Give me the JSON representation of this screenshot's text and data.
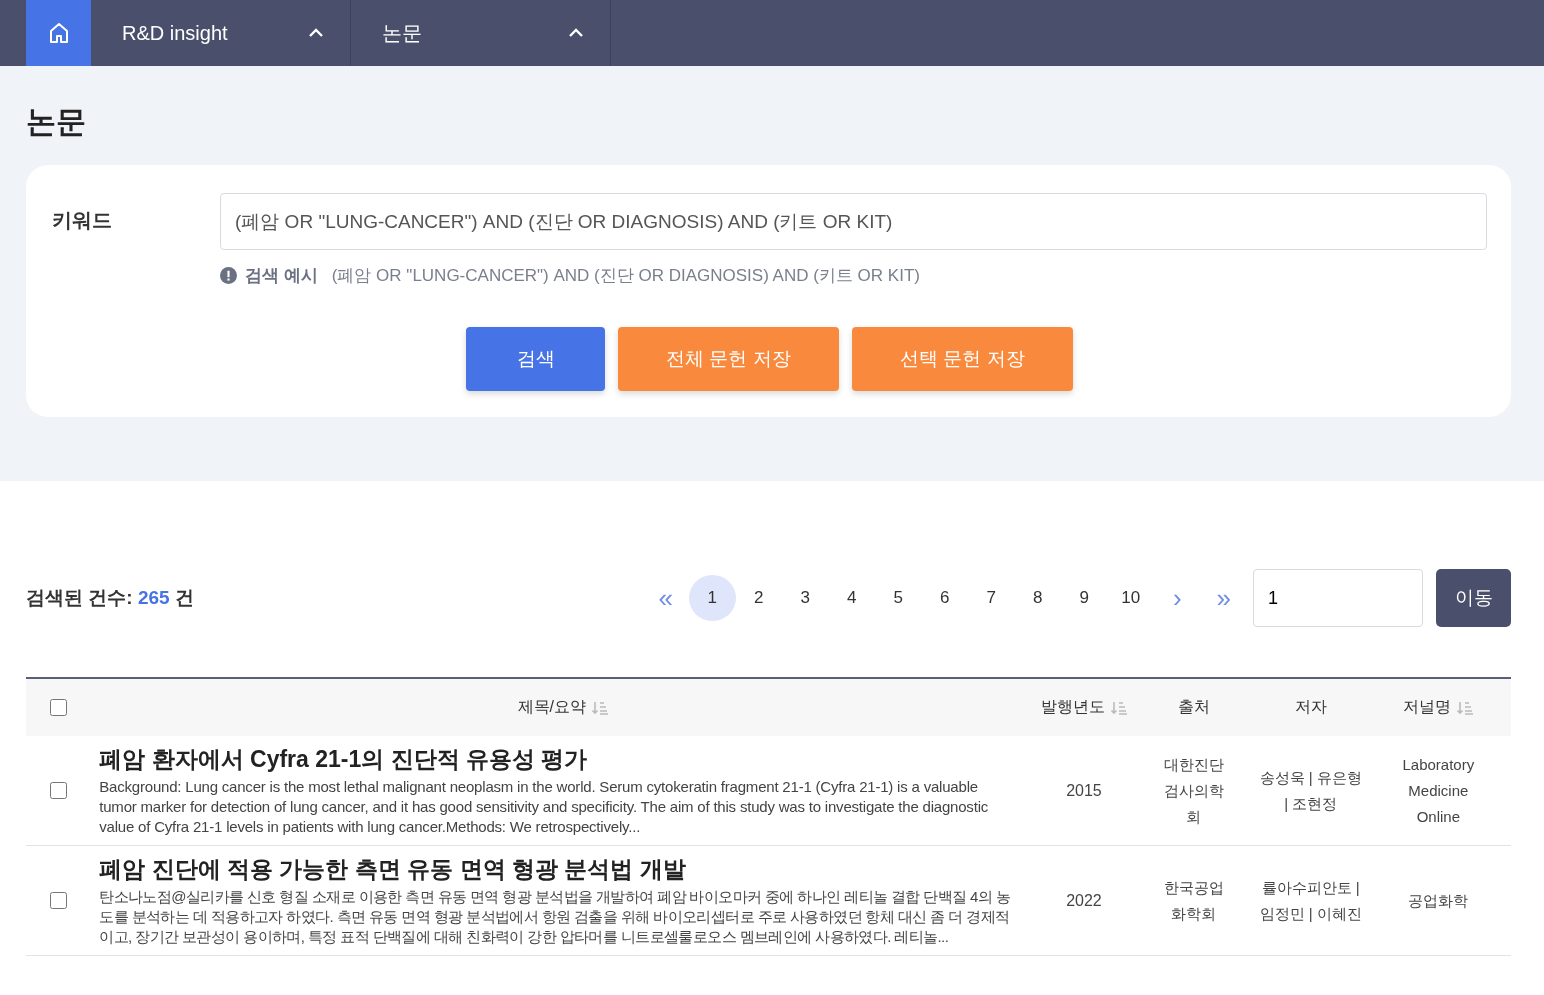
{
  "nav": {
    "items": [
      {
        "label": "R&D insight",
        "expanded": true
      },
      {
        "label": "논문",
        "expanded": true
      }
    ]
  },
  "page_title": "논문",
  "search": {
    "label": "키워드",
    "value": "(폐암 OR \"LUNG-CANCER\") AND (진단 OR DIAGNOSIS) AND (키트 OR KIT)",
    "hint_label": "검색 예시",
    "hint_text": "(폐암 OR \"LUNG-CANCER\") AND (진단 OR DIAGNOSIS) AND (키트 OR KIT)"
  },
  "buttons": [
    {
      "label": "검색",
      "kind": "primary"
    },
    {
      "label": "전체 문헌 저장",
      "kind": "accent"
    },
    {
      "label": "선택 문헌 저장",
      "kind": "accent"
    }
  ],
  "result_count": {
    "label": "검색된 건수:",
    "count": "265",
    "unit": "건"
  },
  "pagination": {
    "first": "«",
    "next": "›",
    "last": "»",
    "pages": [
      {
        "label": "1",
        "selected": true
      },
      {
        "label": "2",
        "selected": false
      },
      {
        "label": "3",
        "selected": false
      },
      {
        "label": "4",
        "selected": false
      },
      {
        "label": "5",
        "selected": false
      },
      {
        "label": "6",
        "selected": false
      },
      {
        "label": "7",
        "selected": false
      },
      {
        "label": "8",
        "selected": false
      },
      {
        "label": "9",
        "selected": false
      },
      {
        "label": "10",
        "selected": false
      }
    ],
    "goto_value": "1",
    "goto_button": "이동"
  },
  "table": {
    "select_all_checked": false,
    "columns": [
      {
        "label": "제목/요약",
        "sortable": true
      },
      {
        "label": "발행년도",
        "sortable": true
      },
      {
        "label": "출처",
        "sortable": false
      },
      {
        "label": "저자",
        "sortable": false
      },
      {
        "label": "저널명",
        "sortable": true
      }
    ],
    "rows": [
      {
        "checked": false,
        "title": "폐암 환자에서 Cyfra 21-1의 진단적 유용성 평가",
        "abstract": "Background: Lung cancer is the most lethal malignant neoplasm in the world. Serum cytokeratin fragment 21-1 (Cyfra 21-1) is a valuable tumor marker for detection of lung cancer, and it has good sensitivity and specificity. The aim of this study was to investigate the diagnostic value of Cyfra 21-1 levels in patients with lung cancer.Methods: We retrospectively...",
        "year": "2015",
        "source": "대한진단검사의학회",
        "authors": "송성욱 | 유은형 | 조현정",
        "journal": "Laboratory Medicine Online"
      },
      {
        "checked": false,
        "title": "폐암 진단에 적용 가능한 측면 유동 면역 형광 분석법 개발",
        "abstract": "탄소나노점@실리카를 신호 형질 소재로 이용한 측면 유동 면역 형광 분석법을 개발하여 폐암 바이오마커 중에 하나인 레티놀 결합 단백질 4의 농도를 분석하는 데 적용하고자 하였다. 측면 유동 면역 형광 분석법에서 항원 검출을 위해 바이오리셉터로 주로 사용하였던 항체 대신 좀 더 경제적이고, 장기간 보관성이 용이하며, 특정 표적 단백질에 대해 친화력이 강한 압타머를 니트로셀룰로오스 멤브레인에 사용하였다. 레티놀...",
        "year": "2022",
        "source": "한국공업화학회",
        "authors": "률아수피안토 | 임정민 | 이혜진",
        "journal": "공업화학"
      }
    ]
  }
}
